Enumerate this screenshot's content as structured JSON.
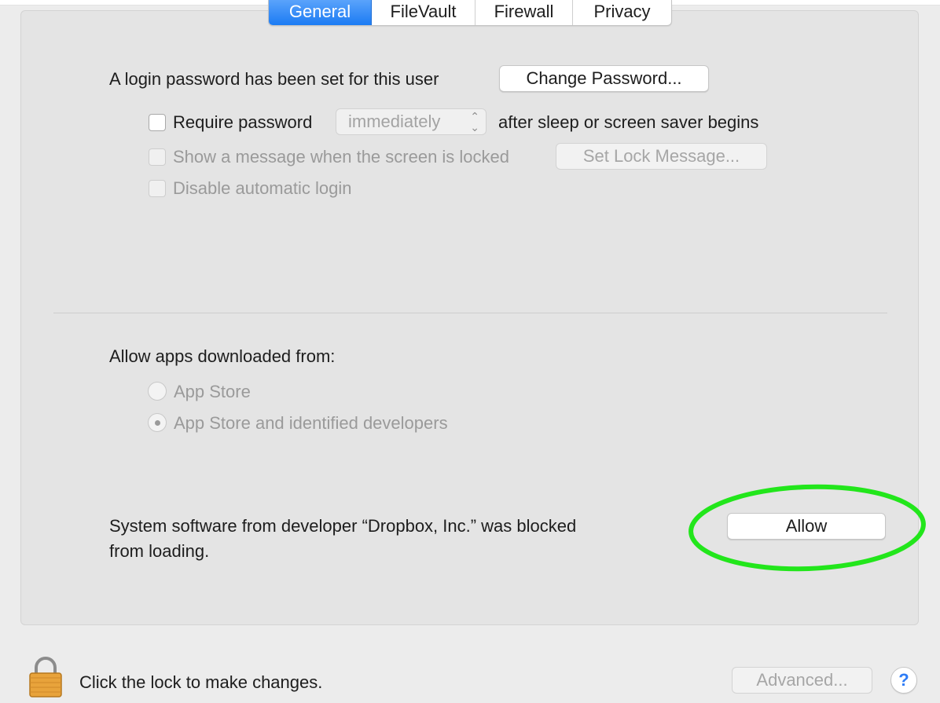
{
  "tabs": [
    {
      "label": "General",
      "active": true
    },
    {
      "label": "FileVault",
      "active": false
    },
    {
      "label": "Firewall",
      "active": false
    },
    {
      "label": "Privacy",
      "active": false
    }
  ],
  "general": {
    "login_password_text": "A login password has been set for this user",
    "change_password_label": "Change Password...",
    "require_password_label": "Require password",
    "require_password_checked": false,
    "require_password_select_value": "immediately",
    "after_sleep_text": "after sleep or screen saver begins",
    "show_message_label": "Show a message when the screen is locked",
    "set_lock_message_label": "Set Lock Message...",
    "disable_auto_login_label": "Disable automatic login"
  },
  "apps": {
    "heading": "Allow apps downloaded from:",
    "options": [
      {
        "label": "App Store",
        "selected": false
      },
      {
        "label": "App Store and identified developers",
        "selected": true
      }
    ]
  },
  "blocked": {
    "line1": "System software from developer “Dropbox, Inc.” was blocked",
    "line2": "from loading.",
    "allow_label": "Allow",
    "highlight_color": "#22e61b"
  },
  "footer": {
    "lock_text": "Click the lock to make changes.",
    "advanced_label": "Advanced...",
    "help_label": "?"
  },
  "colors": {
    "accent": "#1b7bf3",
    "panel_bg": "#e4e4e4",
    "disabled_text": "#9a9a9a"
  },
  "icons": [
    "lock-icon",
    "help-icon",
    "stepper-arrows-icon"
  ]
}
